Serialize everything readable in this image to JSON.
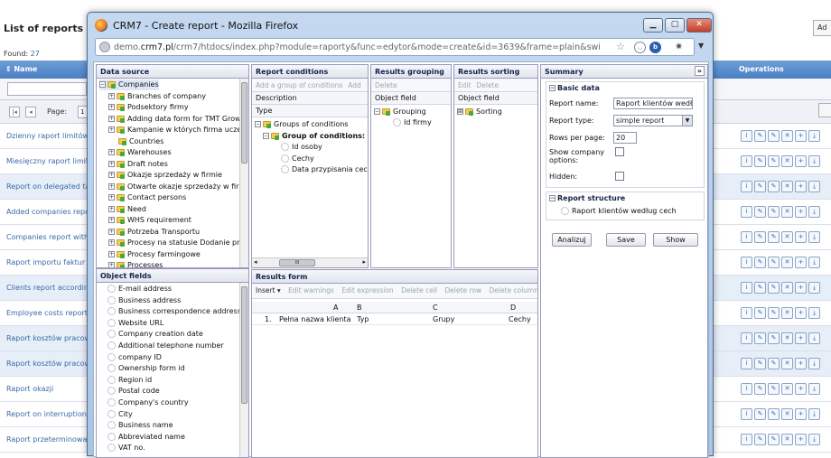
{
  "background": {
    "title": "List of reports",
    "found_label": "Found:",
    "found_count": "27",
    "col_name": "⇕ Name",
    "col_operations": "Operations",
    "pager_label": "Page:",
    "pager_value": "1",
    "add_button": "Ad",
    "rows": [
      "Dzienny raport limitów",
      "Miesięczny raport limit",
      "Report on delegated ta",
      "Added companies repo",
      "Companies report with",
      "Raport importu faktur",
      "Clients report accordin",
      "Employee costs report",
      "Raport kosztów pracow",
      "Raport kosztów pracow",
      "Raport okazji",
      "Report on interruption",
      "Raport przeterminowa"
    ]
  },
  "window": {
    "title": "CRM7 - Create report - Mozilla Firefox",
    "url_prefix": "demo.",
    "url_domain": "crm7.pl",
    "url_rest": "/crm7/htdocs/index.php?module=raporty&func=edytor&mode=create&id=3639&frame=plain&swi"
  },
  "datasource": {
    "title": "Data source",
    "items": [
      "Companies",
      "Branches of company",
      "Podsektory firmy",
      "Adding data form for TMT Growth",
      "Kampanie w których firma uczest",
      "Countries",
      "Warehouses",
      "Draft notes",
      "Okazje sprzedaży w firmie",
      "Otwarte okazje sprzedaży w firmie",
      "Contact persons",
      "Need",
      "WHS requirement",
      "Potrzeba Transportu",
      "Procesy na statusie Dodanie proc",
      "Procesy farmingowe",
      "Processes"
    ]
  },
  "objectfields": {
    "title": "Object fields",
    "items": [
      "E-mail address",
      "Business address",
      "Business correspondence address",
      "Website URL",
      "Company creation date",
      "Additional telephone number",
      "company ID",
      "Ownership form id",
      "Region id",
      "Postal code",
      "Company's country",
      "City",
      "Business name",
      "Abbreviated name",
      "VAT no."
    ]
  },
  "conditions": {
    "title": "Report conditions",
    "toolbar": [
      "Add a group of conditions",
      "Add"
    ],
    "description_label": "Description",
    "type_label": "Type",
    "tree": [
      "Groups of conditions",
      "Group of conditions: and",
      "Id osoby",
      "Cechy",
      "Data przypisania cechy"
    ],
    "hscroll": "III"
  },
  "grouping": {
    "title": "Results grouping",
    "toolbar": [
      "Delete"
    ],
    "col": "Object field",
    "tree": [
      "Grouping",
      "Id firmy"
    ]
  },
  "sorting": {
    "title": "Results sorting",
    "toolbar": [
      "Edit",
      "Delete"
    ],
    "col": "Object field",
    "tree": [
      "Sorting"
    ]
  },
  "resultsform": {
    "title": "Results form",
    "toolbar": [
      "Insert ▾",
      "Edit warnings",
      "Edit expression",
      "Delete cell",
      "Delete row",
      "Delete column"
    ],
    "headers": [
      "A",
      "B",
      "C",
      "D"
    ],
    "rows": [
      {
        "num": "1.",
        "cells": [
          "Pełna nazwa klienta",
          "Typ",
          "Grupy",
          "Cechy"
        ]
      }
    ]
  },
  "summary": {
    "title": "Summary",
    "collapse": "»",
    "basic_title": "Basic data",
    "report_name_label": "Report name:",
    "report_name_value": "Raport klientów według",
    "report_type_label": "Report type:",
    "report_type_value": "simple report",
    "rows_label": "Rows per page:",
    "rows_value": "20",
    "show_company_label": "Show company",
    "show_company_label2": "options:",
    "hidden_label": "Hidden:",
    "structure_title": "Report structure",
    "structure_item": "Raport klientów według cech",
    "buttons": [
      "Analizuj",
      "Save",
      "Show"
    ]
  }
}
